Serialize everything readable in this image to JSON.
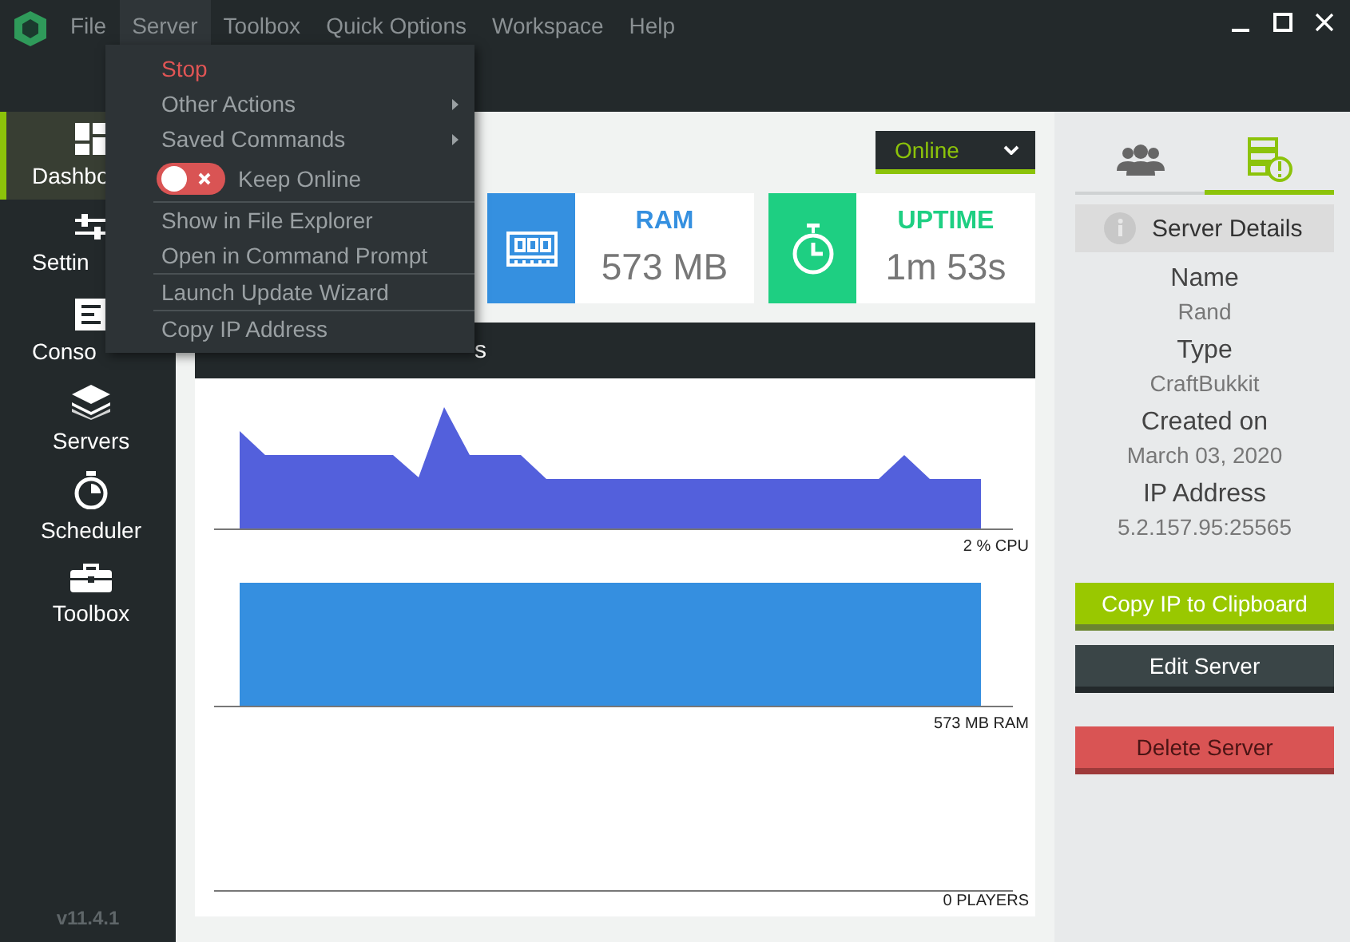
{
  "menubar": [
    {
      "label": "File",
      "selected": false
    },
    {
      "label": "Server",
      "selected": true
    },
    {
      "label": "Toolbox",
      "selected": false
    },
    {
      "label": "Quick Options",
      "selected": false
    },
    {
      "label": "Workspace",
      "selected": false
    },
    {
      "label": "Help",
      "selected": false
    }
  ],
  "server_menu": {
    "groups": [
      [
        {
          "kind": "danger",
          "label": "Stop"
        },
        {
          "kind": "submenu",
          "label": "Other Actions"
        },
        {
          "kind": "submenu",
          "label": "Saved Commands"
        },
        {
          "kind": "toggle",
          "label": "Keep Online",
          "on": false
        }
      ],
      [
        {
          "kind": "item",
          "label": "Show in File Explorer"
        },
        {
          "kind": "item",
          "label": "Open in Command Prompt"
        }
      ],
      [
        {
          "kind": "item",
          "label": "Launch Update Wizard"
        }
      ],
      [
        {
          "kind": "item",
          "label": "Copy IP Address"
        }
      ]
    ]
  },
  "sidebar": {
    "items": [
      {
        "kind": "dashboard",
        "label": "Dashbo",
        "selected": true
      },
      {
        "kind": "settings",
        "label": "Settin",
        "selected": false
      },
      {
        "kind": "console",
        "label": "Conso",
        "selected": false
      },
      {
        "kind": "servers",
        "label": "Servers",
        "selected": false
      },
      {
        "kind": "scheduler",
        "label": "Scheduler",
        "selected": false
      },
      {
        "kind": "toolbox",
        "label": "Toolbox",
        "selected": false
      }
    ],
    "version": "v11.4.1"
  },
  "status_dropdown": {
    "value": "Online"
  },
  "stats": [
    {
      "kind": "ram",
      "title": "RAM",
      "value": "573 MB",
      "color": "#3590e0"
    },
    {
      "kind": "timer",
      "title": "UPTIME",
      "value": "1m 53s",
      "color": "#1ecf82"
    }
  ],
  "chart_panel": {
    "title": "s",
    "charts": [
      {
        "kind": "cpu",
        "label": "2 % CPU"
      },
      {
        "kind": "ram",
        "label": "573 MB RAM"
      },
      {
        "kind": "players",
        "label": "0 PLAYERS"
      }
    ]
  },
  "right_panel": {
    "tabs": [
      {
        "kind": "players",
        "selected": false
      },
      {
        "kind": "server",
        "selected": true
      }
    ],
    "heading": "Server Details",
    "fields": [
      {
        "label": "Name",
        "value": "Rand"
      },
      {
        "label": "Type",
        "value": "CraftBukkit"
      },
      {
        "label": "Created on",
        "value": "March 03, 2020"
      },
      {
        "label": "IP Address",
        "value": "5.2.157.95:25565"
      }
    ],
    "buttons": [
      {
        "kind": "primary",
        "label": "Copy IP to Clipboard"
      },
      {
        "kind": "dark",
        "label": "Edit Server"
      },
      {
        "kind": "danger",
        "label": "Delete Server"
      }
    ]
  }
}
